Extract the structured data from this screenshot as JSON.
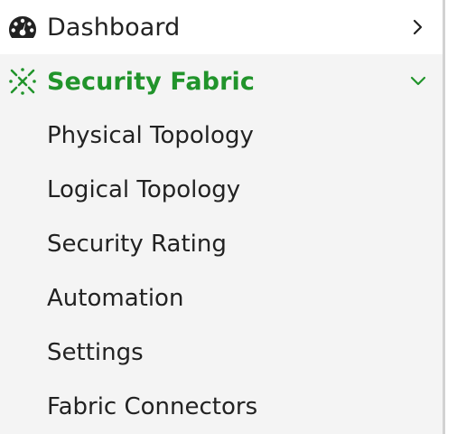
{
  "nav": {
    "dashboard": {
      "label": "Dashboard",
      "icon": "dashboard-gauge-icon",
      "chevron": "chevron-right-icon"
    },
    "security_fabric": {
      "label": "Security Fabric",
      "icon": "security-fabric-icon",
      "chevron": "chevron-down-icon",
      "expanded": true,
      "accent_color": "#21942b",
      "items": [
        {
          "label": "Physical Topology"
        },
        {
          "label": "Logical Topology"
        },
        {
          "label": "Security Rating"
        },
        {
          "label": "Automation"
        },
        {
          "label": "Settings"
        },
        {
          "label": "Fabric Connectors"
        }
      ]
    }
  },
  "colors": {
    "sidebar_bg": "#f4f4f4",
    "top_row_bg": "#ffffff",
    "text": "#222222",
    "active": "#21942b",
    "divider": "#d2d2d2"
  }
}
